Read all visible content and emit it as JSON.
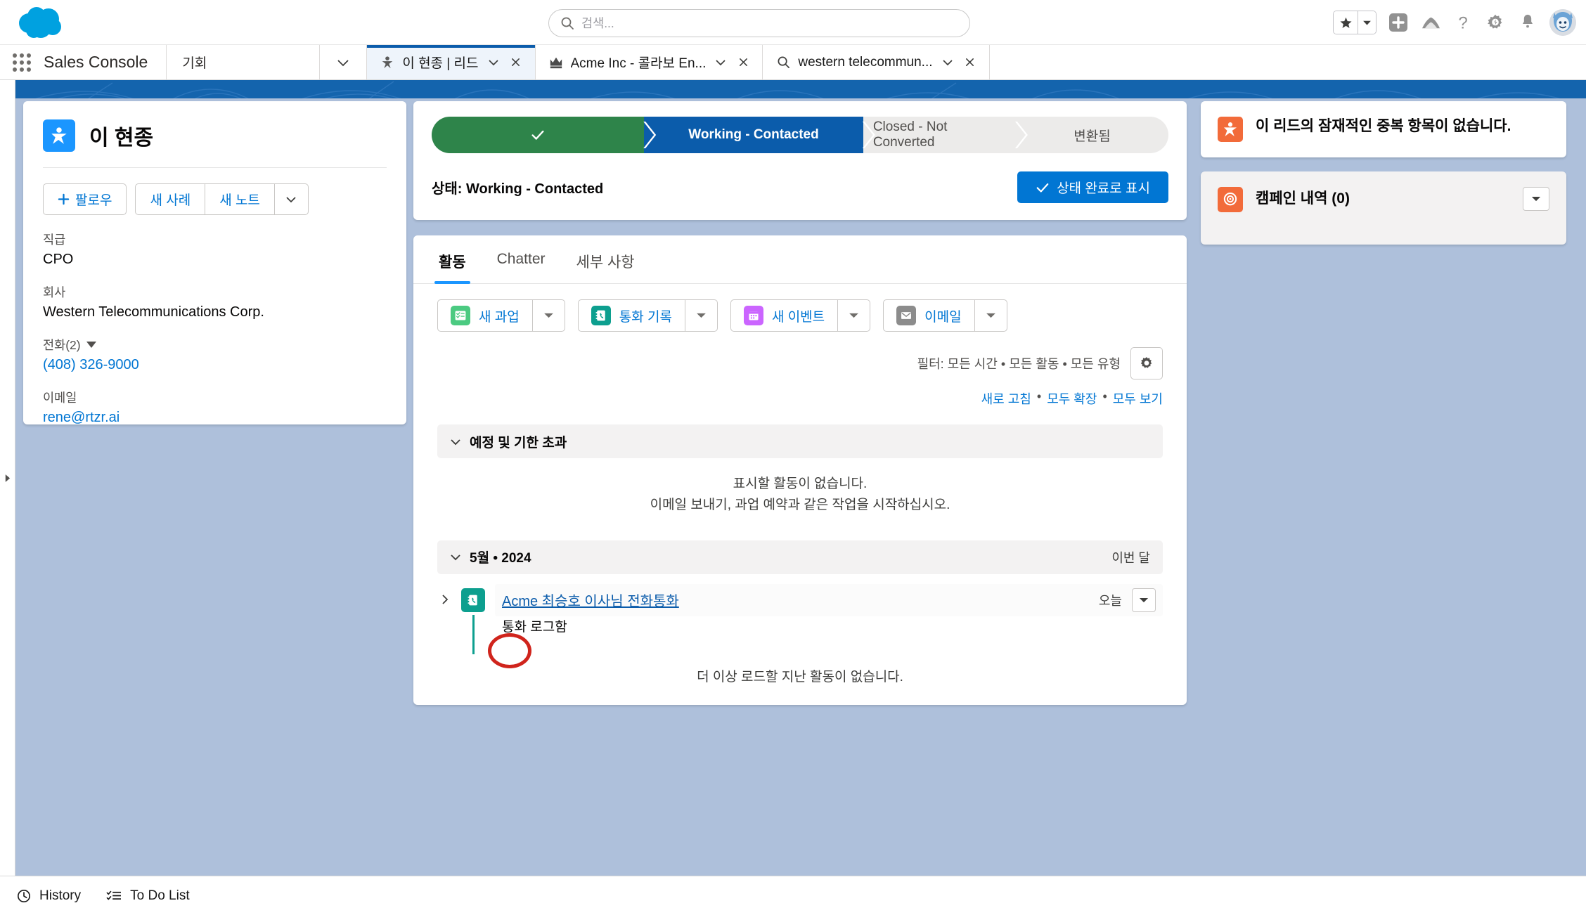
{
  "header": {
    "logo_icon": "salesforce-cloud-logo",
    "search": {
      "placeholder": "검색...",
      "value": "",
      "icon": "search-icon"
    },
    "favorites_icon": "star-icon",
    "favorites_caret_icon": "chevron-down-icon",
    "add_icon": "plus-icon",
    "trailhead_icon": "mountain-icon",
    "help_icon": "question-mark-icon",
    "setup_icon": "gear-icon",
    "notifications_icon": "bell-icon",
    "avatar_icon": "user-avatar"
  },
  "console": {
    "app_launcher_icon": "app-launcher-waffle-icon",
    "app_name": "Sales Console",
    "nav_item": "기회",
    "nav_caret_icon": "chevron-down-icon",
    "tabs": [
      {
        "label": "이 현종 | 리드",
        "icon": "lead-icon",
        "active": true,
        "caret_icon": "chevron-down-icon",
        "close_icon": "close-icon"
      },
      {
        "label": "Acme Inc - 콜라보 En...",
        "icon": "opportunity-crown-icon",
        "active": false,
        "caret_icon": "chevron-down-icon",
        "close_icon": "close-icon"
      },
      {
        "label": "western telecommun...",
        "icon": "search-icon",
        "active": false,
        "caret_icon": "chevron-down-icon",
        "close_icon": "close-icon"
      }
    ]
  },
  "lead_panel": {
    "badge_icon": "lead-person-icon",
    "name": "이 현종",
    "buttons": [
      {
        "label": "팔로우",
        "icon": "plus-icon"
      },
      {
        "label": "새 사례",
        "icon": ""
      },
      {
        "label": "새 노트",
        "icon": ""
      }
    ],
    "more_caret_icon": "chevron-down-icon",
    "fields": [
      {
        "label": "직급",
        "value": "CPO",
        "link": false
      },
      {
        "label": "회사",
        "value": "Western Telecommunications Corp.",
        "link": false
      },
      {
        "label": "전화(2)",
        "value": "(408) 326-9000",
        "link": true,
        "has_caret": true
      },
      {
        "label": "이메일",
        "value": "rene@rtzr.ai",
        "link": true
      }
    ]
  },
  "path": {
    "steps": [
      {
        "label": "",
        "state": "done",
        "icon": "check-icon"
      },
      {
        "label": "Working - Contacted",
        "state": "current"
      },
      {
        "label": "Closed - Not Converted",
        "state": "upcoming"
      },
      {
        "label": "변환됨",
        "state": "upcoming"
      }
    ],
    "status_prefix": "상태: ",
    "status_value": "Working - Contacted",
    "complete_button": {
      "label": "상태 완료로 표시",
      "icon": "check-icon"
    }
  },
  "detail_tabs": [
    {
      "label": "활동",
      "active": true
    },
    {
      "label": "Chatter",
      "active": false
    },
    {
      "label": "세부 사항",
      "active": false
    }
  ],
  "activity_actions": [
    {
      "label": "새 과업",
      "icon": "task-icon",
      "icon_color": "#4bca81",
      "caret_icon": "chevron-down-icon"
    },
    {
      "label": "통화 기록",
      "icon": "log-call-icon",
      "icon_color": "#0d9f8f",
      "caret_icon": "chevron-down-icon"
    },
    {
      "label": "새 이벤트",
      "icon": "event-calendar-icon",
      "icon_color": "#cb65ff",
      "caret_icon": "chevron-down-icon"
    },
    {
      "label": "이메일",
      "icon": "email-icon",
      "icon_color": "#8c8c8c",
      "caret_icon": "chevron-down-icon"
    }
  ],
  "filter": {
    "text": "필터: 모든 시간 • 모든 활동 • 모든 유형",
    "gear_icon": "gear-icon",
    "links": [
      "새로 고침",
      "모두 확장",
      "모두 보기"
    ],
    "separator": "•"
  },
  "timeline": {
    "upcoming": {
      "header": "예정 및 기한 초과",
      "chevron_icon": "chevron-down-icon",
      "empty_line1": "표시할 활동이 없습니다.",
      "empty_line2": "이메일 보내기, 과업 예약과 같은 작업을 시작하십시오."
    },
    "month_group": {
      "header": "5월 • 2024",
      "chevron_icon": "chevron-down-icon",
      "badge": "이번 달"
    },
    "items": [
      {
        "expand_icon": "chevron-right-icon",
        "type_icon": "log-call-icon",
        "title": "Acme 최승호 이사님 전화통화",
        "subtitle": "통화 로그함",
        "time": "오늘",
        "caret_icon": "chevron-down-icon"
      }
    ],
    "footer": "더 이상 로드할 지난 활동이 없습니다."
  },
  "right_panel": {
    "duplicates": {
      "icon": "lead-person-icon",
      "text": "이 리드의 잠재적인 중복 항목이 없습니다."
    },
    "campaign_history": {
      "icon": "campaign-target-icon",
      "title": "캠페인 내역 (0)",
      "caret_icon": "chevron-down-icon"
    }
  },
  "footer": {
    "items": [
      {
        "label": "History",
        "icon": "clock-icon"
      },
      {
        "label": "To Do List",
        "icon": "checklist-icon"
      }
    ]
  },
  "annotation": {
    "shape": "red-circle",
    "color": "#d0241c",
    "target": "Acme"
  },
  "colors": {
    "brand_blue": "#0176d3",
    "path_current": "#0b5cab",
    "path_done": "#2e844a",
    "background": "#aec0db",
    "accent_teal": "#0d9f8f",
    "accent_orange": "#f26b3a"
  }
}
